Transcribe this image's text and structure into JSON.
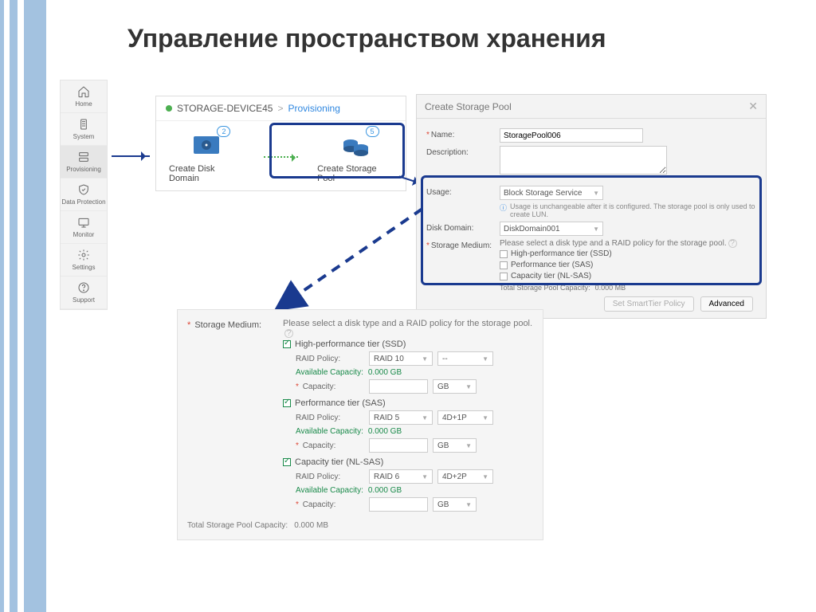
{
  "slide_title": "Управление пространством хранения",
  "sidebar": [
    {
      "label": "Home",
      "icon": "home"
    },
    {
      "label": "System",
      "icon": "system"
    },
    {
      "label": "Provisioning",
      "icon": "prov"
    },
    {
      "label": "Data Protection",
      "icon": "shield"
    },
    {
      "label": "Monitor",
      "icon": "monitor"
    },
    {
      "label": "Settings",
      "icon": "gear"
    },
    {
      "label": "Support",
      "icon": "help"
    }
  ],
  "breadcrumb": {
    "device": "STORAGE-DEVICE45",
    "page": "Provisioning",
    "sep": ">"
  },
  "prov": {
    "disk_domain": {
      "label": "Create Disk Domain",
      "badge": "2"
    },
    "storage_pool": {
      "label": "Create Storage Pool",
      "badge": "5"
    }
  },
  "dialog": {
    "title": "Create Storage Pool",
    "name_label": "Name:",
    "name_value": "StoragePool006",
    "desc_label": "Description:",
    "usage_label": "Usage:",
    "usage_value": "Block Storage Service",
    "usage_note": "Usage is unchangeable after it is configured. The storage pool is only used to create LUN.",
    "disk_domain_label": "Disk Domain:",
    "disk_domain_value": "DiskDomain001",
    "medium_label": "Storage Medium:",
    "medium_instr": "Please select a disk type and a RAID policy for the storage pool.",
    "tiers": [
      "High-performance tier (SSD)",
      "Performance tier (SAS)",
      "Capacity tier (NL-SAS)"
    ],
    "total_label": "Total Storage Pool Capacity:",
    "total_value": "0.000 MB",
    "btn_smart": "Set SmartTier Policy",
    "btn_adv": "Advanced"
  },
  "detail": {
    "medium_label": "Storage Medium:",
    "instr": "Please select a disk type and a RAID policy for the storage pool.",
    "raid_label": "RAID Policy:",
    "avail_label": "Available Capacity:",
    "avail_value": "0.000 GB",
    "cap_label": "Capacity:",
    "cap_unit": "GB",
    "tiers": [
      {
        "name": "High-performance tier (SSD)",
        "raid": "RAID 10",
        "layout": "--"
      },
      {
        "name": "Performance tier (SAS)",
        "raid": "RAID 5",
        "layout": "4D+1P"
      },
      {
        "name": "Capacity tier (NL-SAS)",
        "raid": "RAID 6",
        "layout": "4D+2P"
      }
    ],
    "total_label": "Total Storage Pool Capacity:",
    "total_value": "0.000 MB"
  }
}
